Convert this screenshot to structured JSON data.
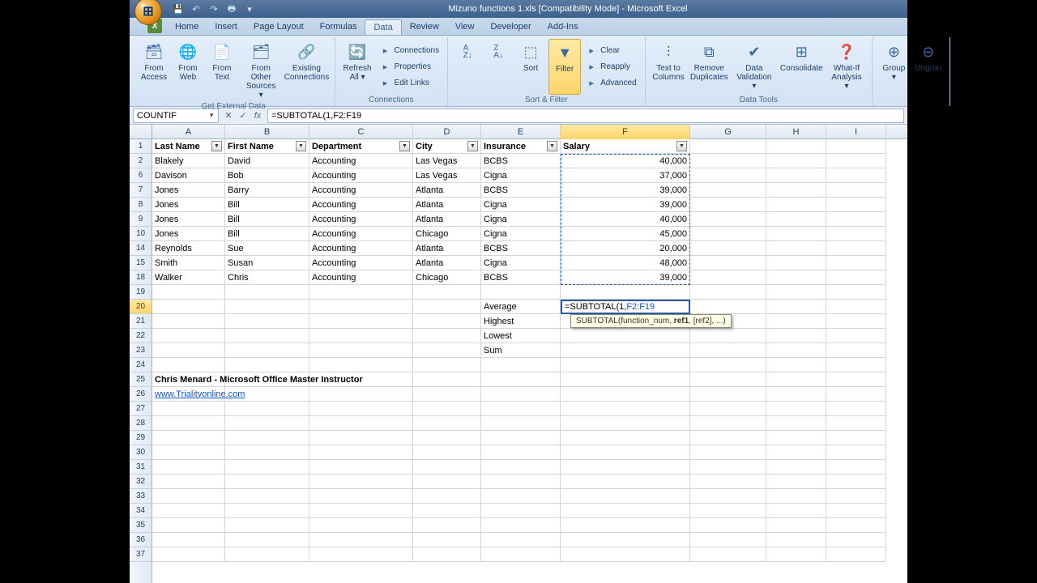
{
  "title": "Mizuno functions 1.xls  [Compatibility Mode] - Microsoft Excel",
  "tabs": [
    "Home",
    "Insert",
    "Page Layout",
    "Formulas",
    "Data",
    "Review",
    "View",
    "Developer",
    "Add-Ins"
  ],
  "active_tab": "Data",
  "ribbon": {
    "groups": [
      {
        "label": "Get External Data",
        "items": [
          {
            "name": "from-access",
            "label": "From\nAccess"
          },
          {
            "name": "from-web",
            "label": "From\nWeb"
          },
          {
            "name": "from-text",
            "label": "From\nText"
          },
          {
            "name": "from-other-sources",
            "label": "From Other\nSources ▾"
          },
          {
            "name": "existing-connections",
            "label": "Existing\nConnections"
          }
        ]
      },
      {
        "label": "Connections",
        "items": [
          {
            "name": "refresh-all",
            "label": "Refresh\nAll ▾"
          }
        ],
        "side": [
          {
            "name": "connections",
            "label": "Connections"
          },
          {
            "name": "properties",
            "label": "Properties"
          },
          {
            "name": "edit-links",
            "label": "Edit Links"
          }
        ]
      },
      {
        "label": "Sort & Filter",
        "items": [
          {
            "name": "sort-asc",
            "label": "A↓Z"
          },
          {
            "name": "sort-desc",
            "label": "Z↓A"
          },
          {
            "name": "sort",
            "label": "Sort"
          },
          {
            "name": "filter",
            "label": "Filter",
            "highlight": true
          }
        ],
        "side": [
          {
            "name": "clear",
            "label": "Clear"
          },
          {
            "name": "reapply",
            "label": "Reapply"
          },
          {
            "name": "advanced",
            "label": "Advanced"
          }
        ]
      },
      {
        "label": "Data Tools",
        "items": [
          {
            "name": "text-to-columns",
            "label": "Text to\nColumns"
          },
          {
            "name": "remove-duplicates",
            "label": "Remove\nDuplicates"
          },
          {
            "name": "data-validation",
            "label": "Data\nValidation ▾"
          },
          {
            "name": "consolidate",
            "label": "Consolidate"
          },
          {
            "name": "whatif",
            "label": "What-If\nAnalysis ▾"
          }
        ]
      },
      {
        "label": "",
        "items": [
          {
            "name": "group",
            "label": "Group ▾"
          },
          {
            "name": "ungroup",
            "label": "Ungrou"
          }
        ]
      }
    ]
  },
  "namebox": "COUNTIF",
  "formula": "=SUBTOTAL(1,F2:F19",
  "formula_display_prefix": "=SUBTOTAL(1,",
  "formula_display_range": "F2:F19",
  "tooltip": "SUBTOTAL(function_num, ref1, [ref2], ...)",
  "columns": [
    "A",
    "B",
    "C",
    "D",
    "E",
    "F",
    "G",
    "H",
    "I"
  ],
  "active_col": "F",
  "row_numbers": [
    1,
    2,
    6,
    7,
    8,
    9,
    10,
    14,
    15,
    18,
    19,
    20,
    21,
    22,
    23,
    24,
    25,
    26,
    27,
    28,
    29,
    30,
    31,
    32,
    33,
    34,
    35,
    36,
    37
  ],
  "active_row": 20,
  "headers": [
    "Last Name",
    "First Name",
    "Department",
    "City",
    "Insurance",
    "Salary"
  ],
  "data_rows": [
    {
      "r": 2,
      "a": "Blakely",
      "b": "David",
      "c": "Accounting",
      "d": "Las Vegas",
      "e": "BCBS",
      "f": "40,000"
    },
    {
      "r": 6,
      "a": "Davison",
      "b": "Bob",
      "c": "Accounting",
      "d": "Las Vegas",
      "e": "Cigna",
      "f": "37,000"
    },
    {
      "r": 7,
      "a": "Jones",
      "b": "Barry",
      "c": "Accounting",
      "d": "Atlanta",
      "e": "BCBS",
      "f": "39,000"
    },
    {
      "r": 8,
      "a": "Jones",
      "b": "Bill",
      "c": "Accounting",
      "d": "Atlanta",
      "e": "Cigna",
      "f": "39,000"
    },
    {
      "r": 9,
      "a": "Jones",
      "b": "Bill",
      "c": "Accounting",
      "d": "Atlanta",
      "e": "Cigna",
      "f": "40,000"
    },
    {
      "r": 10,
      "a": "Jones",
      "b": "Bill",
      "c": "Accounting",
      "d": "Chicago",
      "e": "Cigna",
      "f": "45,000"
    },
    {
      "r": 14,
      "a": "Reynolds",
      "b": "Sue",
      "c": "Accounting",
      "d": "Atlanta",
      "e": "BCBS",
      "f": "20,000"
    },
    {
      "r": 15,
      "a": "Smith",
      "b": "Susan",
      "c": "Accounting",
      "d": "Atlanta",
      "e": "Cigna",
      "f": "48,000"
    },
    {
      "r": 18,
      "a": "Walker",
      "b": "Chris",
      "c": "Accounting",
      "d": "Chicago",
      "e": "BCBS",
      "f": "39,000"
    }
  ],
  "summary_rows": [
    {
      "r": 20,
      "e": "Average",
      "f_formula": true
    },
    {
      "r": 21,
      "e": "Highest"
    },
    {
      "r": 22,
      "e": "Lowest"
    },
    {
      "r": 23,
      "e": "Sum"
    }
  ],
  "footer_rows": {
    "25": "Chris Menard - Microsoft Office Master Instructor",
    "26": "www.Trialityonline.com"
  }
}
